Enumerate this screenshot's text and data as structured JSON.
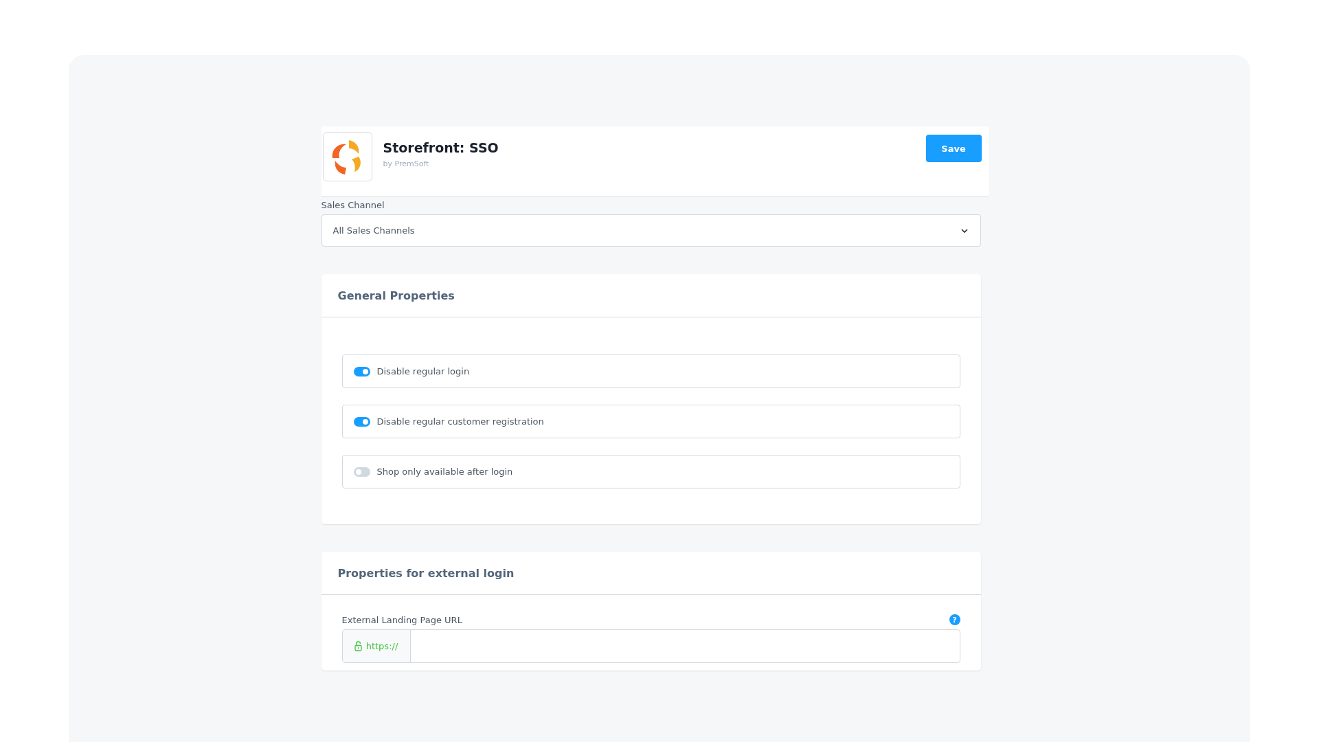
{
  "header": {
    "title": "Storefront: SSO",
    "vendor": "by PremSoft",
    "save_button": "Save"
  },
  "sales_channel": {
    "label": "Sales Channel",
    "value": "All Sales Channels"
  },
  "general_properties": {
    "title": "General Properties",
    "toggles": [
      {
        "label": "Disable regular login",
        "on": true
      },
      {
        "label": "Disable regular customer registration",
        "on": true
      },
      {
        "label": "Shop only available after login",
        "on": false
      }
    ]
  },
  "external_login": {
    "title": "Properties for external login",
    "url_field": {
      "label": "External Landing Page URL",
      "help": "?",
      "prefix": "https://"
    }
  }
}
